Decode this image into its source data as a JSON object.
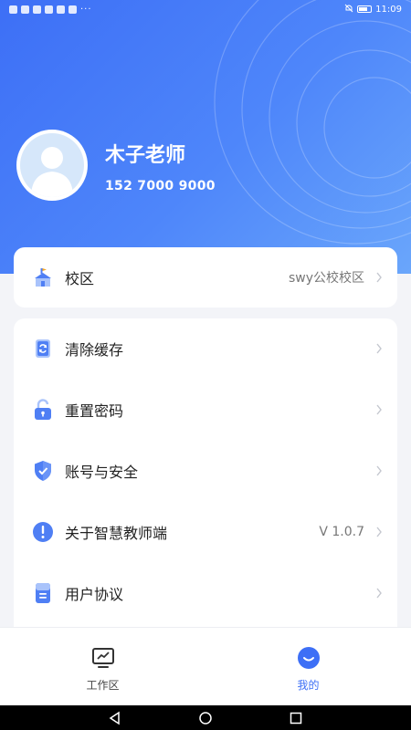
{
  "status_bar": {
    "time": "11:09",
    "notification_dots": "···"
  },
  "profile": {
    "name": "木子老师",
    "phone": "152 7000 9000"
  },
  "campus": {
    "label": "校区",
    "value": "swy公校校区"
  },
  "menu": [
    {
      "label": "清除缓存",
      "value": "",
      "icon": "clear-cache-icon"
    },
    {
      "label": "重置密码",
      "value": "",
      "icon": "unlock-icon"
    },
    {
      "label": "账号与安全",
      "value": "",
      "icon": "shield-check-icon"
    },
    {
      "label": "关于智慧教师端",
      "value": "V 1.0.7",
      "icon": "info-exclamation-icon"
    },
    {
      "label": "用户协议",
      "value": "",
      "icon": "document-icon"
    }
  ],
  "tabbar": {
    "work_label": "工作区",
    "mine_label": "我的"
  },
  "colors": {
    "accent": "#3d6ff6",
    "icon_blue": "#4f7ff4",
    "icon_light": "#a9c3fb"
  }
}
